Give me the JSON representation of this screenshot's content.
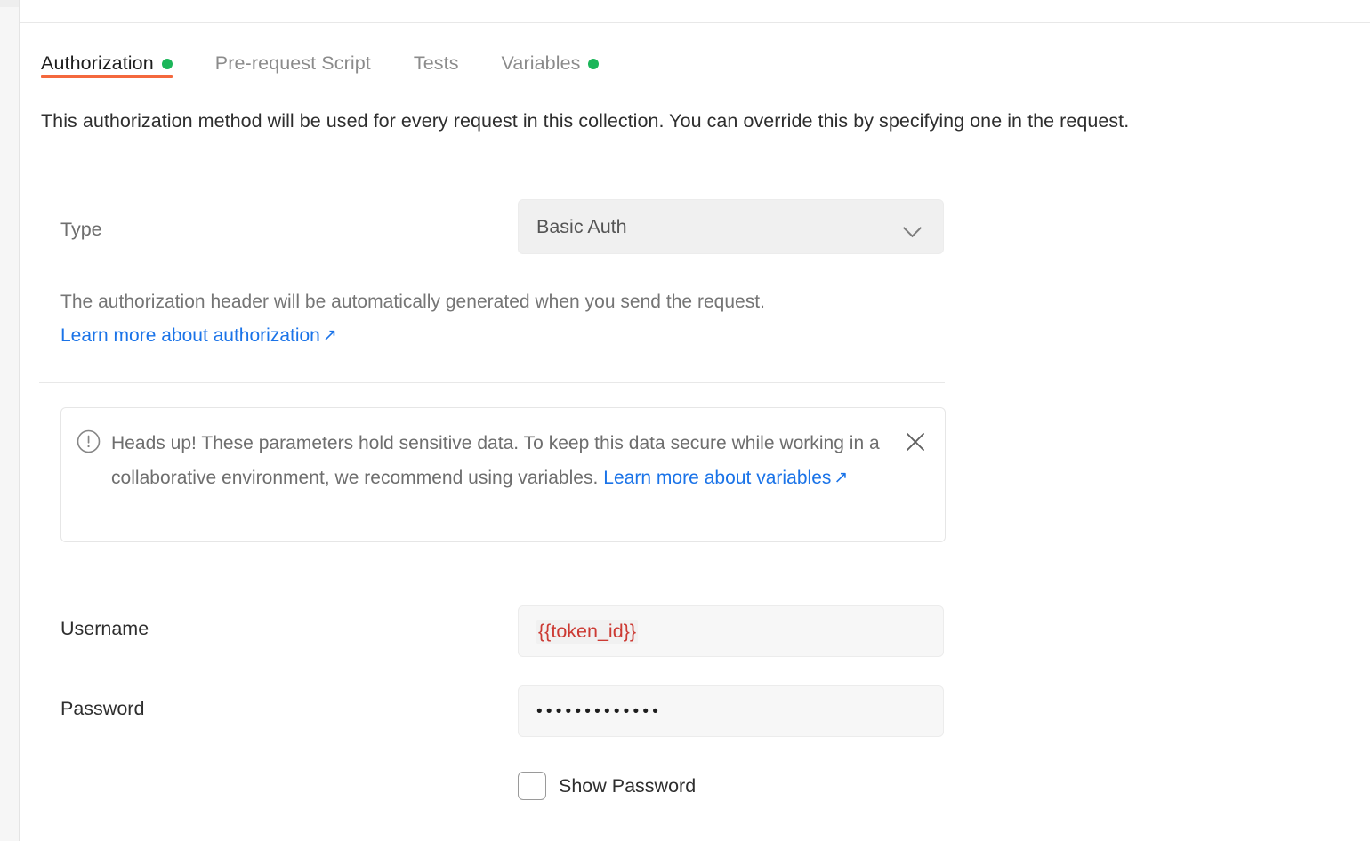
{
  "tabs": [
    {
      "label": "Authorization",
      "active": true,
      "dot": true,
      "name": "tab-authorization"
    },
    {
      "label": "Pre-request Script",
      "active": false,
      "dot": false,
      "name": "tab-pre-request-script"
    },
    {
      "label": "Tests",
      "active": false,
      "dot": false,
      "name": "tab-tests"
    },
    {
      "label": "Variables",
      "active": false,
      "dot": true,
      "name": "tab-variables"
    }
  ],
  "description": "This authorization method will be used for every request in this collection. You can override this by specifying one in the request.",
  "type_row": {
    "label": "Type",
    "selected": "Basic Auth",
    "chevron_icon": "chevron-down-icon"
  },
  "helper": {
    "text": "The authorization header will be automatically generated when you send the request.",
    "link_text": "Learn more about authorization",
    "link_arrow": "↗"
  },
  "callout": {
    "icon": "exclamation-circle-icon",
    "text_before_link": "Heads up! These parameters hold sensitive data. To keep this data secure while working in a collaborative environment, we recommend using variables. ",
    "link_text": "Learn more about variables",
    "link_arrow": "↗",
    "close_icon": "close-icon"
  },
  "fields": {
    "username": {
      "label": "Username",
      "value": "{{token_id}}",
      "placeholder": "Username"
    },
    "password": {
      "label": "Password",
      "masked_value": "•••••••••••••",
      "placeholder": "Password"
    }
  },
  "show_password": {
    "label": "Show Password",
    "checked": false
  },
  "colors": {
    "accent_orange": "#f4683d",
    "status_green": "#1cb65a",
    "link_blue": "#1a73e8",
    "variable_red": "#cc3a33"
  }
}
